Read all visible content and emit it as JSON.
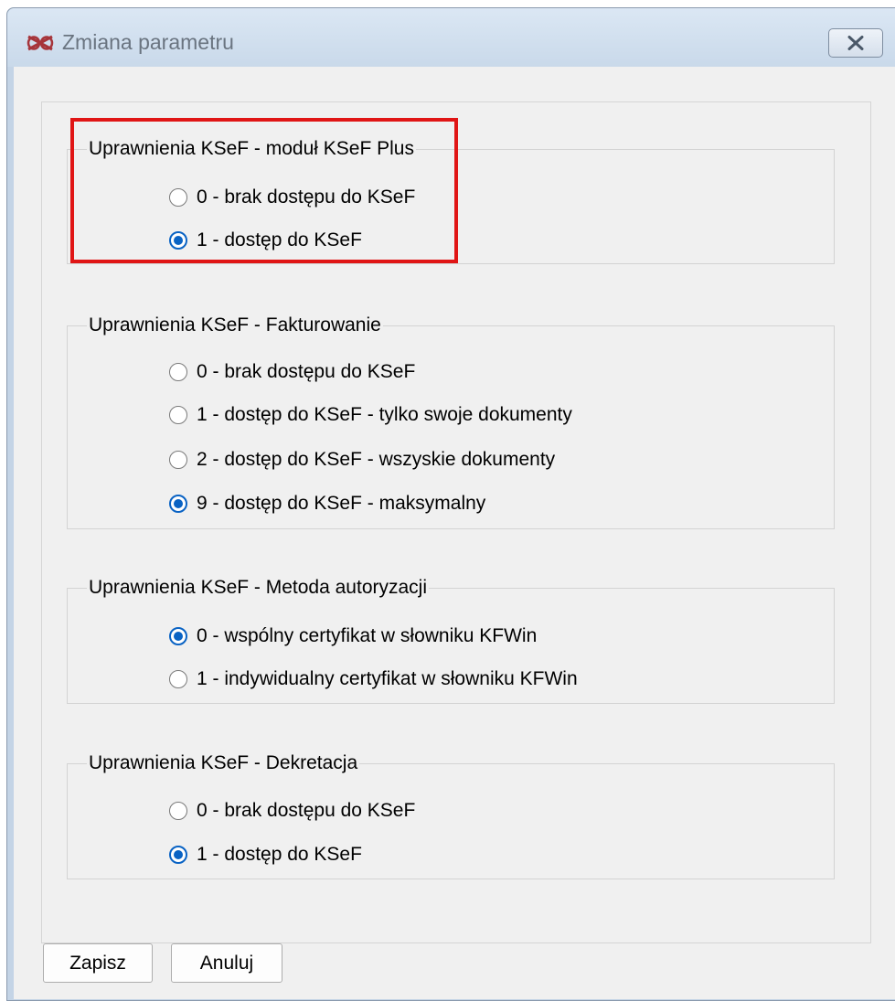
{
  "window": {
    "title": "Zmiana parametru"
  },
  "groups": [
    {
      "title": "Uprawnienia KSeF - moduł KSeF Plus",
      "highlighted": true,
      "options": [
        {
          "label": "0 - brak dostępu do KSeF",
          "checked": false
        },
        {
          "label": "1 - dostęp do KSeF",
          "checked": true
        }
      ]
    },
    {
      "title": "Uprawnienia KSeF - Fakturowanie",
      "highlighted": false,
      "options": [
        {
          "label": "0 - brak dostępu do KSeF",
          "checked": false
        },
        {
          "label": "1 - dostęp do KSeF - tylko swoje dokumenty",
          "checked": false
        },
        {
          "label": "2 - dostęp do KSeF - wszyskie dokumenty",
          "checked": false
        },
        {
          "label": "9 - dostęp do KSeF - maksymalny",
          "checked": true
        }
      ]
    },
    {
      "title": "Uprawnienia KSeF - Metoda autoryzacji",
      "highlighted": false,
      "options": [
        {
          "label": "0 - wspólny certyfikat w słowniku KFWin",
          "checked": true
        },
        {
          "label": "1 - indywidualny certyfikat w słowniku KFWin",
          "checked": false
        }
      ]
    },
    {
      "title": "Uprawnienia KSeF - Dekretacja",
      "highlighted": false,
      "options": [
        {
          "label": "0 - brak dostępu do KSeF",
          "checked": false
        },
        {
          "label": "1 - dostęp do KSeF",
          "checked": true
        }
      ]
    }
  ],
  "buttons": {
    "save_label": "Zapisz",
    "cancel_label": "Anuluj"
  },
  "colors": {
    "highlight": "#e01515",
    "radio_accent": "#0a63c4"
  }
}
